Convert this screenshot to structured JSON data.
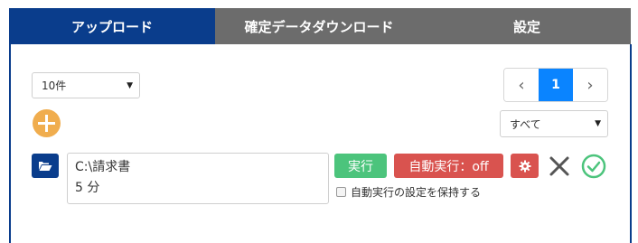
{
  "tabs": [
    {
      "label": "アップロード",
      "active": true
    },
    {
      "label": "確定データダウンロード",
      "active": false
    },
    {
      "label": "設定",
      "active": false
    }
  ],
  "page_size_select": {
    "value": "10件"
  },
  "pager": {
    "prev": "‹",
    "current": "1",
    "next": "›"
  },
  "filter_select": {
    "value": "すべて"
  },
  "upload_item": {
    "path": "C:\\請求書",
    "interval": "5 分",
    "run_label": "実行",
    "auto_run_label": "自動実行：off",
    "keep_setting_label": "自動実行の設定を保持する"
  },
  "colors": {
    "accent": "#0a3d8c",
    "tab_inactive": "#6c6c6c",
    "run": "#4cc47c",
    "danger": "#d9534f",
    "add": "#f0ad4e",
    "page_active": "#0a84ff"
  }
}
